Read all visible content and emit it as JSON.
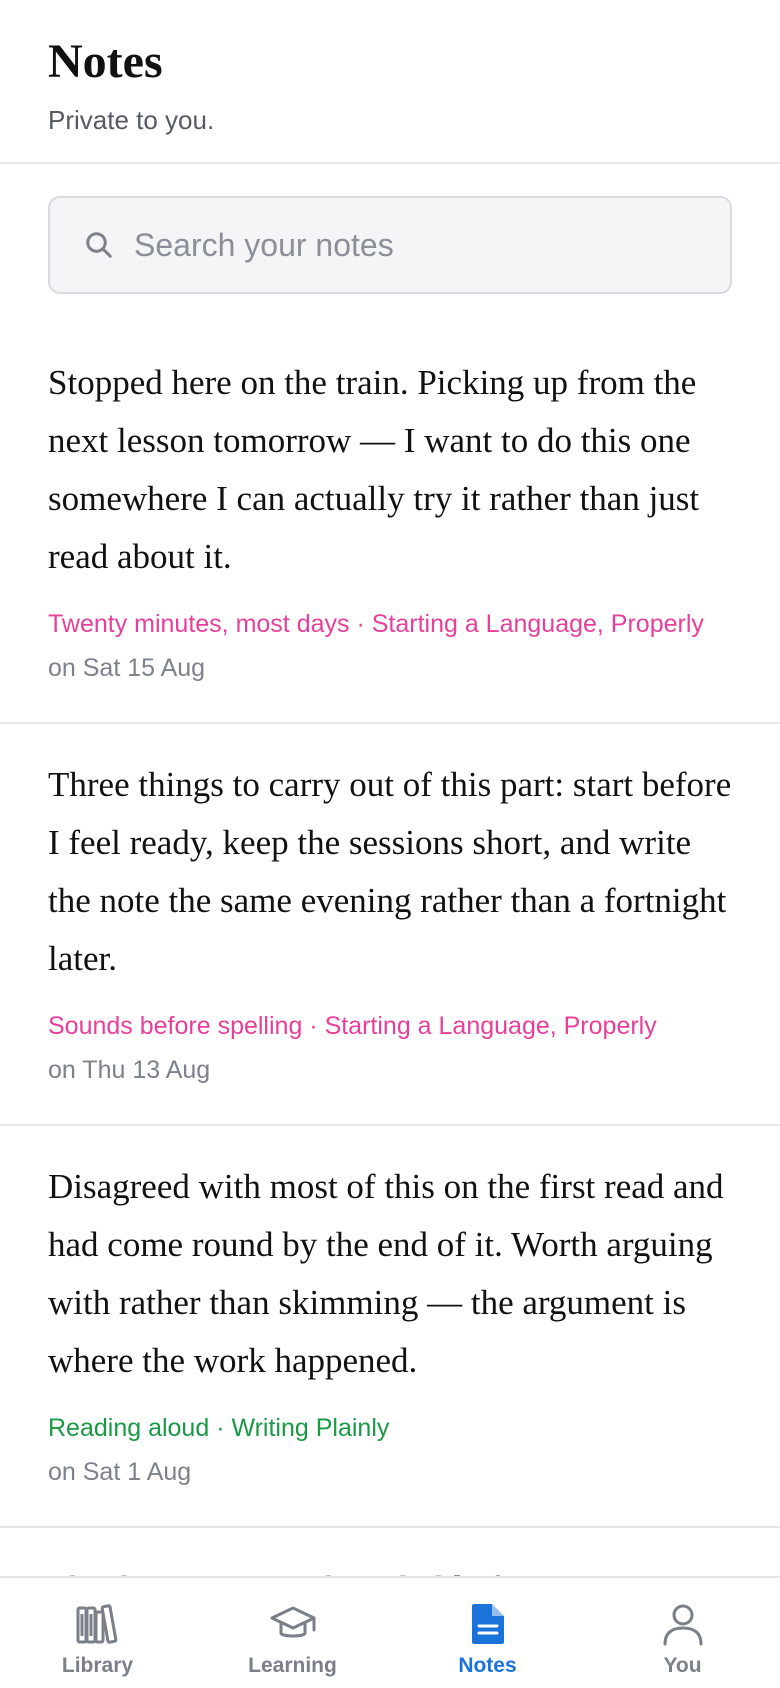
{
  "header": {
    "title": "Notes",
    "subtitle": "Private to you."
  },
  "search": {
    "placeholder": "Search your notes",
    "icon": "search-icon"
  },
  "notes": [
    {
      "text": "Stopped here on the train. Picking up from the next lesson tomorrow — I want to do this one somewhere I can actually try it rather than just read about it.",
      "meta": "Twenty minutes, most days · Starting a Language, Properly",
      "meta_color": "#e8409a",
      "date": "on Sat 15 Aug"
    },
    {
      "text": "Three things to carry out of this part: start before I feel ready, keep the sessions short, and write the note the same evening rather than a fortnight later.",
      "meta": "Sounds before spelling · Starting a Language, Properly",
      "meta_color": "#e8409a",
      "date": "on Thu 13 Aug"
    },
    {
      "text": "Disagreed with most of this on the first read and had come round by the end of it. Worth arguing with rather than skimming — the argument is where the work happened.",
      "meta": "Reading aloud · Writing Plainly",
      "meta_color": "#1a9a44",
      "date": "on Sat 1 Aug"
    },
    {
      "text": "The thing I want to keep hold of…"
    }
  ],
  "tabs": [
    {
      "label": "Library",
      "icon": "library-icon",
      "active": false
    },
    {
      "label": "Learning",
      "icon": "graduation-cap-icon",
      "active": false
    },
    {
      "label": "Notes",
      "icon": "document-icon",
      "active": true
    },
    {
      "label": "You",
      "icon": "person-icon",
      "active": false
    }
  ],
  "colors": {
    "accent": "#1a73d9",
    "pink": "#e8409a",
    "green": "#1a9a44"
  }
}
